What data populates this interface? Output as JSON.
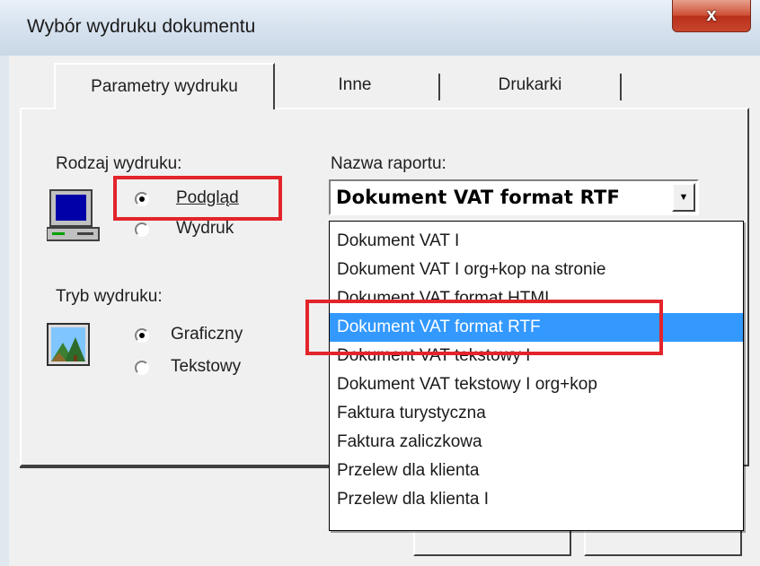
{
  "window": {
    "title": "Wybór wydruku dokumentu",
    "close_symbol": "x"
  },
  "tabs": [
    {
      "label": "Parametry wydruku"
    },
    {
      "label": "Inne"
    },
    {
      "label": "Drukarki"
    }
  ],
  "print_type": {
    "label": "Rodzaj wydruku:",
    "options": [
      {
        "label": "Podgląd",
        "checked": true
      },
      {
        "label": "Wydruk",
        "checked": false
      }
    ],
    "icon": "computer-icon"
  },
  "print_mode": {
    "label": "Tryb wydruku:",
    "options": [
      {
        "label": "Graficzny",
        "checked": true
      },
      {
        "label": "Tekstowy",
        "checked": false
      }
    ],
    "icon": "picture-icon"
  },
  "report": {
    "label": "Nazwa raportu:",
    "selected": "Dokument VAT format RTF",
    "options": [
      "Dokument VAT I",
      "Dokument VAT I org+kop na stronie",
      "Dokument VAT format HTML",
      "Dokument VAT format RTF",
      "Dokument VAT tekstowy I",
      "Dokument VAT tekstowy I org+kop",
      "Faktura turystyczna",
      "Faktura zaliczkowa",
      "Przelew dla klienta",
      "Przelew dla klienta I"
    ],
    "highlighted_index": 3
  },
  "colors": {
    "highlight": "#3399ff",
    "annotation": "#e3242b"
  }
}
